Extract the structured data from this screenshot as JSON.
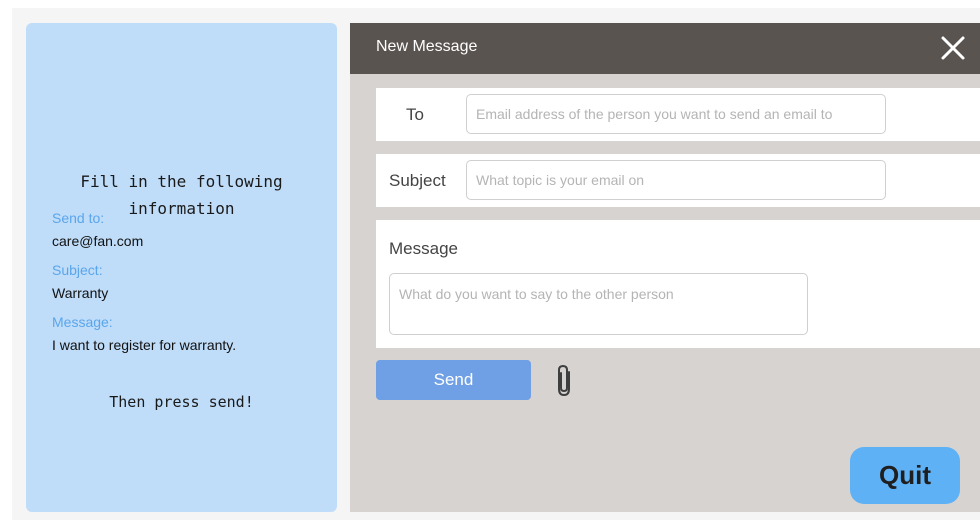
{
  "instructions": {
    "title": "Fill in the following information",
    "send_to_label": "Send to:",
    "send_to_value": "care@fan.com",
    "subject_label": "Subject:",
    "subject_value": "Warranty",
    "message_label": "Message:",
    "message_value": "I want to register for warranty.",
    "footer": "Then press send!"
  },
  "window": {
    "title": "New Message",
    "close_icon": "close-icon"
  },
  "form": {
    "to_label": "To",
    "to_placeholder": "Email address of the person you want to send an email to",
    "to_value": "",
    "subject_label": "Subject",
    "subject_placeholder": "What topic is your email on",
    "subject_value": "",
    "message_label": "Message",
    "message_placeholder": "What do you want to say to the other person",
    "message_value": ""
  },
  "actions": {
    "send_label": "Send",
    "attach_icon": "paperclip-icon",
    "quit_label": "Quit"
  },
  "colors": {
    "instructions_bg": "#bfdcf8",
    "label_accent": "#5aa6ec",
    "header_bg": "#5a5450",
    "window_bg": "#d7d3d1",
    "send_button": "#6f9fe4",
    "quit_button": "#5fb1f5"
  }
}
